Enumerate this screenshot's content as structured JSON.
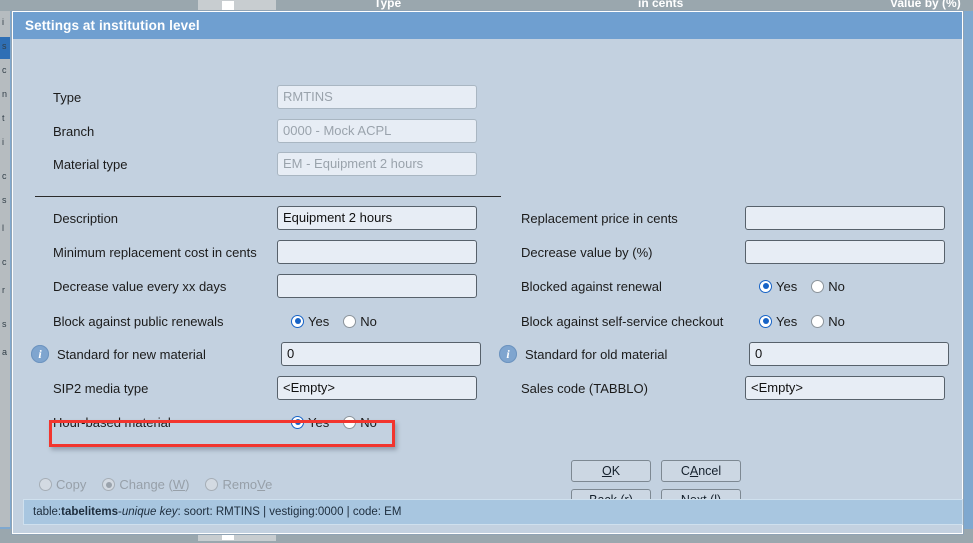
{
  "background": {
    "column_headers": [
      "Type",
      "in cents",
      "Value by (%)"
    ],
    "row_glyphs": [
      "i",
      "s",
      "c",
      "n",
      "t",
      "i",
      "c",
      "s",
      "l",
      "c",
      "r",
      "s",
      "a"
    ]
  },
  "dialog": {
    "title": "Settings at institution level",
    "header_fields": [
      {
        "label": "Type",
        "value": "RMTINS",
        "disabled": true
      },
      {
        "label": "Branch",
        "value": "0000 - Mock ACPL",
        "disabled": true
      },
      {
        "label": "Material type",
        "value": "EM - Equipment 2 hours",
        "disabled": true
      }
    ],
    "left_column": [
      {
        "label": "Description",
        "type": "text",
        "value": "Equipment 2 hours"
      },
      {
        "label": "Minimum replacement cost in cents",
        "type": "text",
        "value": ""
      },
      {
        "label": "Decrease value every xx days",
        "type": "text",
        "value": ""
      },
      {
        "label": "Block against public renewals",
        "type": "radio",
        "yes_label": "Yes",
        "no_label": "No",
        "selected": "yes"
      },
      {
        "label": "Standard for new material",
        "type": "text",
        "value": "0",
        "info": true
      },
      {
        "label": "SIP2 media type",
        "type": "text",
        "value": "<Empty>"
      },
      {
        "label": "Hour-based material",
        "type": "radio",
        "yes_label": "Yes",
        "no_label": "No",
        "selected": "yes",
        "highlighted": true
      }
    ],
    "right_column": [
      {
        "label": "Replacement price in cents",
        "type": "text",
        "value": ""
      },
      {
        "label": "Decrease value by (%)",
        "type": "text",
        "value": ""
      },
      {
        "label": "Blocked against renewal",
        "type": "radio",
        "yes_label": "Yes",
        "no_label": "No",
        "selected": "yes"
      },
      {
        "label": "Block against self-service checkout",
        "type": "radio",
        "yes_label": "Yes",
        "no_label": "No",
        "selected": "yes"
      },
      {
        "label": "Standard for old material",
        "type": "text",
        "value": "0",
        "info": true
      },
      {
        "label": "Sales code (TABBLO)",
        "type": "text",
        "value": "<Empty>"
      }
    ],
    "action_modes": [
      {
        "label": "Copy",
        "selected": false,
        "disabled": true
      },
      {
        "label": "Change (W)",
        "selected": true,
        "disabled": true,
        "accel": "W"
      },
      {
        "label": "RemoVe",
        "selected": false,
        "disabled": true,
        "accel": "V"
      }
    ],
    "buttons": [
      {
        "label": "OK",
        "accel": "O"
      },
      {
        "label": "CAncel",
        "accel": "A"
      },
      {
        "label": "Back (r)",
        "accel": "r"
      },
      {
        "label": "Next (l)",
        "accel": "l"
      }
    ],
    "status": {
      "prefix": "table: ",
      "table": "tabelitems",
      "sep": " - ",
      "key_label": "unique key",
      "suffix": ": soort: RMTINS | vestiging:0000 | code: EM"
    }
  },
  "colors": {
    "titlebar": "#6f9fd0",
    "dialog_bg": "#c3d1e0",
    "highlight": "#f2352e",
    "radio_on": "#1763c6",
    "status_bg": "#a8c6e0"
  }
}
